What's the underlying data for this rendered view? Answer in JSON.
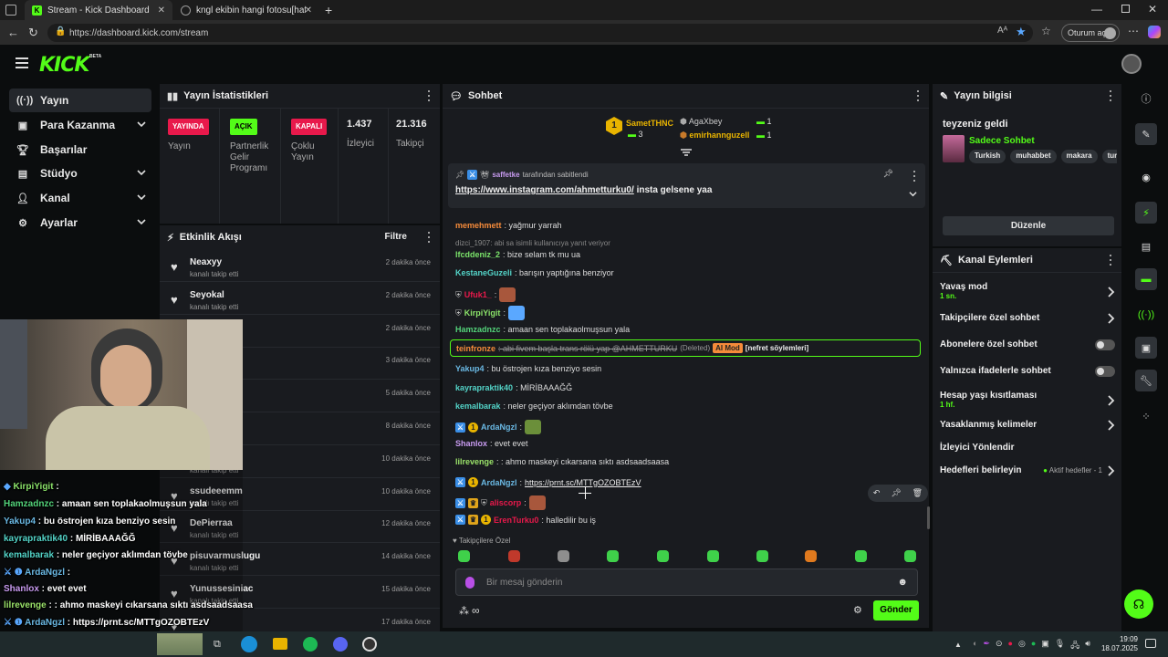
{
  "browser": {
    "tabs": [
      {
        "title": "Stream - Kick Dashboard"
      },
      {
        "title": "kngl ekibin hangi fotosu[hafif gün"
      }
    ],
    "url": "https://dashboard.kick.com/stream",
    "profile_label": "Oturum aç"
  },
  "header": {
    "logo": "KICK",
    "logo_tag": "BETA"
  },
  "sidebar": {
    "items": [
      {
        "label": "Yayın",
        "icon": "broadcast-icon"
      },
      {
        "label": "Para Kazanma",
        "icon": "dollar-icon"
      },
      {
        "label": "Başarılar",
        "icon": "trophy-icon"
      },
      {
        "label": "Stüdyo",
        "icon": "studio-icon"
      },
      {
        "label": "Kanal",
        "icon": "user-icon"
      },
      {
        "label": "Ayarlar",
        "icon": "gear-icon"
      }
    ]
  },
  "stats": {
    "title": "Yayın İstatistikleri",
    "cols": [
      {
        "badge": "YAYINDA",
        "label": "Yayın",
        "color": "#e8194b",
        "fg": "#fff"
      },
      {
        "badge": "AÇIK",
        "label": "Partnerlik\nGelir\nProgramı",
        "color": "#53fc18",
        "fg": "#000"
      },
      {
        "badge": "KAPALI",
        "label": "Çoklu\nYayın",
        "color": "#e8194b",
        "fg": "#fff"
      },
      {
        "badge": "1.437",
        "label": "İzleyici"
      },
      {
        "badge": "21.316",
        "label": "Takipçi"
      }
    ]
  },
  "activity": {
    "title": "Etkinlik Akışı",
    "filter": "Filtre",
    "items": [
      {
        "name": "Neaxyy",
        "sub": "kanalı takip etti",
        "time": "2 dakika önce"
      },
      {
        "name": "Seyokal",
        "sub": "kanalı takip etti",
        "time": "2 dakika önce"
      },
      {
        "name": "s",
        "sub": "",
        "time": "2 dakika önce"
      },
      {
        "name": "",
        "sub": "",
        "time": "3 dakika önce"
      },
      {
        "name": "cak23",
        "sub": "",
        "time": "5 dakika önce"
      },
      {
        "name": "",
        "sub": "",
        "time": "8 dakika önce"
      },
      {
        "name": "",
        "sub": "kanalı takip etti",
        "time": "10 dakika önce"
      },
      {
        "name": "ssudeeemm",
        "sub": "kanalı takip etti",
        "time": "10 dakika önce"
      },
      {
        "name": "DePierraa",
        "sub": "kanalı takip etti",
        "time": "12 dakika önce"
      },
      {
        "name": "pisuvarmuslugu",
        "sub": "kanalı takip etti",
        "time": "14 dakika önce"
      },
      {
        "name": "Yunussesiniac",
        "sub": "kanalı takip etti",
        "time": "15 dakika önce"
      },
      {
        "name": "",
        "sub": "",
        "time": "17 dakika önce"
      }
    ]
  },
  "chat": {
    "title": "Sohbet",
    "top": [
      {
        "name": "SametTHNC",
        "count": "3"
      },
      {
        "name": "AgaXbey",
        "count": "1"
      },
      {
        "name": "emirhannguzell",
        "count": "1"
      }
    ],
    "pinned": {
      "by": "saffetke",
      "note": "tarafından sabitlendi",
      "link": "https://www.instagram.com/ahmetturku0/",
      "text": "insta gelsene yaa"
    },
    "messages": [
      {
        "user": "memehmett",
        "color": "#f58b3a",
        "text": ": yağmur yarrah"
      },
      {
        "reply": "dizci_1907: abi sa isimli kullanıcıya yanıt veriyor"
      },
      {
        "user": "lfcddeniz_2",
        "color": "#7be36a",
        "text": ": bize selam tk mu ua"
      },
      {
        "user": "KestaneGuzeli",
        "color": "#53d3c7",
        "text": ": barışın yaptığına benziyor"
      },
      {
        "user": "Ufuk1_",
        "color": "#e8194b",
        "text": ":"
      },
      {
        "user": "KirpiYigit",
        "color": "#8be36a",
        "text": ":"
      },
      {
        "user": "Hamzadnzc",
        "color": "#53d37a",
        "text": ": amaan sen toplakaolmuşsun yala"
      },
      {
        "user": "teinfronze",
        "color": "#f58b3a",
        "text": ": abi fivem başla trans rölü yap @AHMETTURKU",
        "deleted": "(Deleted)",
        "mod": "AI Mod",
        "reason": "[nefret söylemleri]"
      },
      {
        "user": "Yakup4",
        "color": "#6ab8e3",
        "text": ": bu östrojen kıza benziyo sesin"
      },
      {
        "user": "kayrapraktik40",
        "color": "#53d3c7",
        "text": ": MİRİBAAAĞĞ"
      },
      {
        "user": "kemalbarak",
        "color": "#53d3c7",
        "text": ": neler geçiyor aklımdan tövbe"
      },
      {
        "user": "ArdaNgzl",
        "color": "#6ab8e3",
        "text": ":"
      },
      {
        "user": "Shanlox",
        "color": "#c89bf0",
        "text": ": evet evet"
      },
      {
        "user": "lilrevenge",
        "color": "#9be36a",
        "text": ": : ahmo maskeyi cıkarsana sıktı asdsaadsaasa"
      },
      {
        "user": "ArdaNgzl",
        "color": "#6ab8e3",
        "text": ":",
        "link": "https://prnt.sc/MTTgOZOBTEzV"
      },
      {
        "user": "aliscorp",
        "color": "#e8194b",
        "text": ":"
      },
      {
        "user": "ErenTurku0",
        "color": "#e8194b",
        "text": ": halledilir bu iş"
      }
    ],
    "emote_section": "Takipçilere Özel",
    "input_placeholder": "Bir mesaj gönderin",
    "send": "Gönder"
  },
  "info": {
    "title": "Yayın bilgisi",
    "stream_title": "teyzeniz geldi",
    "mode": "Sadece Sohbet",
    "tags": [
      "Turkish",
      "muhabbet",
      "makara",
      "tur"
    ],
    "edit": "Düzenle"
  },
  "actions": {
    "title": "Kanal Eylemleri",
    "items": [
      {
        "label": "Yavaş mod",
        "sub": "1 sn.",
        "ctrl": "chev"
      },
      {
        "label": "Takipçilere özel sohbet",
        "ctrl": "chev"
      },
      {
        "label": "Abonelere özel sohbet",
        "ctrl": "switch"
      },
      {
        "label": "Yalnızca ifadelerle sohbet",
        "ctrl": "switch"
      },
      {
        "label": "Hesap yaşı kısıtlaması",
        "sub": "1 hf.",
        "ctrl": "chev"
      },
      {
        "label": "Yasaklanmış kelimeler",
        "ctrl": "chev"
      },
      {
        "label": "İzleyici Yönlendir",
        "ctrl": "none"
      },
      {
        "label": "Hedefleri belirleyin",
        "note": "Aktif hedefler - 1",
        "ctrl": "chev"
      }
    ]
  },
  "overlay": {
    "lines": [
      {
        "u": "KirpiYigit",
        "c": "#8be36a",
        "t": " :"
      },
      {
        "u": "Hamzadnzc",
        "c": "#53d37a",
        "t": " : amaan sen toplakaolmuşsun yala"
      },
      {
        "u": "Yakup4",
        "c": "#6ab8e3",
        "t": " : bu östrojen kıza benziyo sesin"
      },
      {
        "u": "kayrapraktik40",
        "c": "#53d3c7",
        "t": " : MİRİBAAAĞĞ"
      },
      {
        "u": "kemalbarak",
        "c": "#53d3c7",
        "t": " : neler geçiyor aklımdan tövbe"
      },
      {
        "u": "ArdaNgzl",
        "c": "#6ab8e3",
        "t": " :"
      },
      {
        "u": "Shanlox",
        "c": "#c89bf0",
        "t": " : evet evet"
      },
      {
        "u": "lilrevenge",
        "c": "#9be36a",
        "t": " : : ahmo maskeyi cıkarsana sıktı asdsaadsaasa"
      },
      {
        "u": "ArdaNgzl",
        "c": "#6ab8e3",
        "t": " : https://prnt.sc/MTTgOZOBTEzV"
      },
      {
        "u": "aliscorp",
        "c": "#e8194b",
        "t": " :"
      }
    ]
  },
  "taskbar": {
    "time": "19:09",
    "date": "18.07.2025"
  }
}
